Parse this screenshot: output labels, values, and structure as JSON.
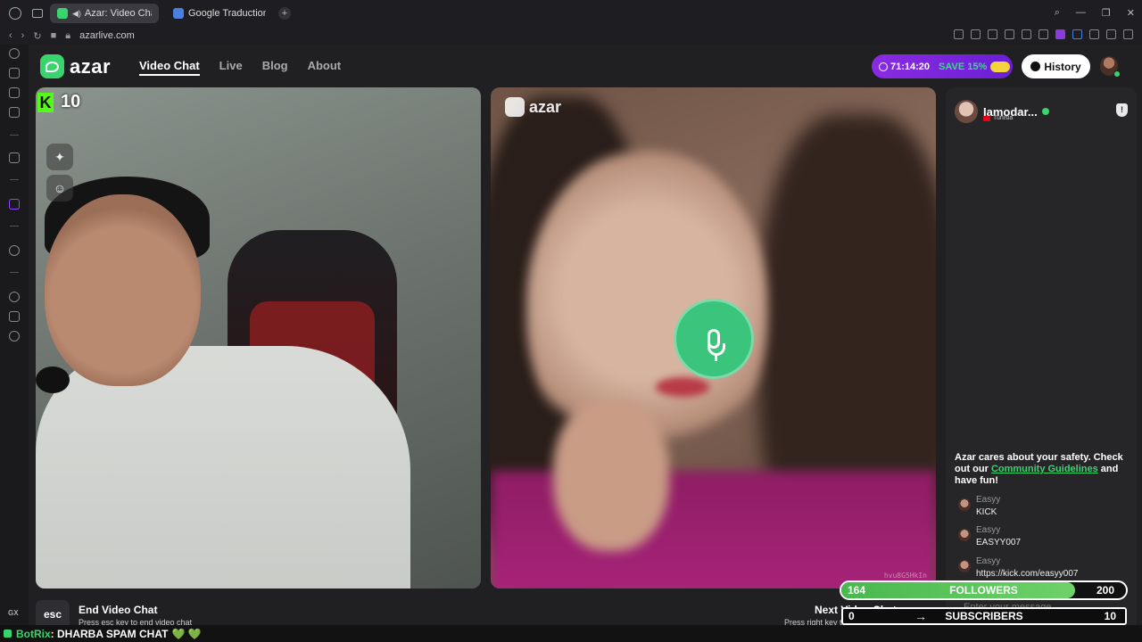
{
  "browser": {
    "tabs": [
      {
        "title": "Azar: Video Chat | Alt",
        "active": true
      },
      {
        "title": "Google Traduction",
        "active": false
      }
    ],
    "new_tab": "+",
    "url": "azarlive.com",
    "controls": [
      "⌕",
      "—",
      "❐",
      "✕"
    ]
  },
  "sidebar": {
    "label": "GX"
  },
  "site": {
    "logo": "azar",
    "nav": [
      "Video Chat",
      "Live",
      "Blog",
      "About"
    ],
    "promo": {
      "timer": "71:14:20",
      "save": "SAVE 15%"
    },
    "history_label": "History"
  },
  "left_video": {
    "kick_logo": "K",
    "viewer_count": "10",
    "tools": [
      "✦",
      "☺"
    ]
  },
  "right_video": {
    "watermark": "azar",
    "id_tag": "hvu8G5HkIn"
  },
  "chat": {
    "peer_name": "Iamodar...",
    "peer_country": "Tunisia",
    "report_icon": "!",
    "safety_pre": "Azar cares about your safety. Check out our ",
    "safety_link": "Community Guidelines",
    "safety_post": " and have fun!",
    "messages": [
      {
        "user": "Easyy",
        "text": "KICK"
      },
      {
        "user": "Easyy",
        "text": "EASYY007"
      },
      {
        "user": "Easyy",
        "text": "https://kick.com/easyy007"
      }
    ],
    "input_placeholder": "Enter your message"
  },
  "bottom": {
    "esc_key": "esc",
    "end_title": "End Video Chat",
    "end_hint": "Press esc key to end video chat",
    "next_title": "Next Video Chat",
    "next_hint": "Press right key to meet others"
  },
  "overlay": {
    "followers": {
      "current": "164",
      "label": "FOLLOWERS",
      "goal": "200",
      "progress": 0.82
    },
    "subscribers": {
      "current": "0",
      "label": "SUBSCRIBERS",
      "goal": "10"
    },
    "bot": {
      "name": "BotRix",
      "message": ": DHARBA SPAM CHAT",
      "hearts": "💚 💚"
    }
  },
  "colors": {
    "accent": "#3ad46e",
    "promo": "#8a2be2",
    "kick": "#53fc18"
  }
}
